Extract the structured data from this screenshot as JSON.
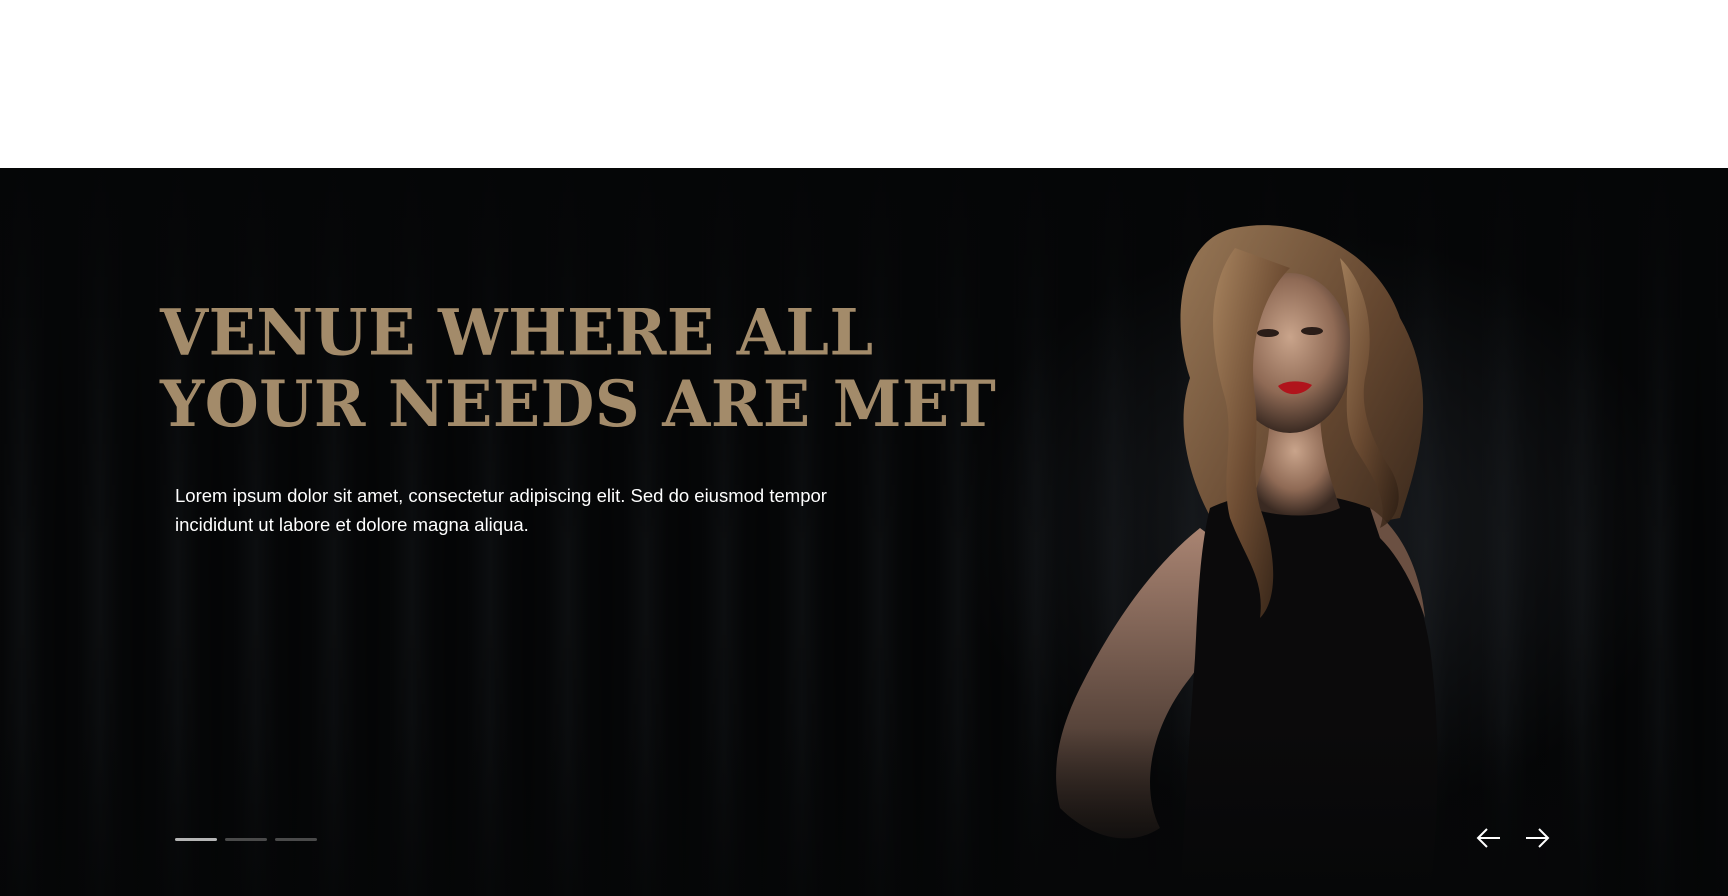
{
  "hero": {
    "headline_line1": "VENUE WHERE ALL",
    "headline_line2": "YOUR NEEDS ARE MET",
    "lead": "Lorem ipsum dolor sit amet, consectetur adipiscing elit. Sed do eiusmod tempor incididunt ut labore et dolore magna aliqua.",
    "accent_color": "#a38b6a",
    "background_color": "#060708"
  },
  "slider": {
    "slide_count": 3,
    "active_index": 0,
    "prev_icon": "arrow-left-icon",
    "next_icon": "arrow-right-icon"
  }
}
